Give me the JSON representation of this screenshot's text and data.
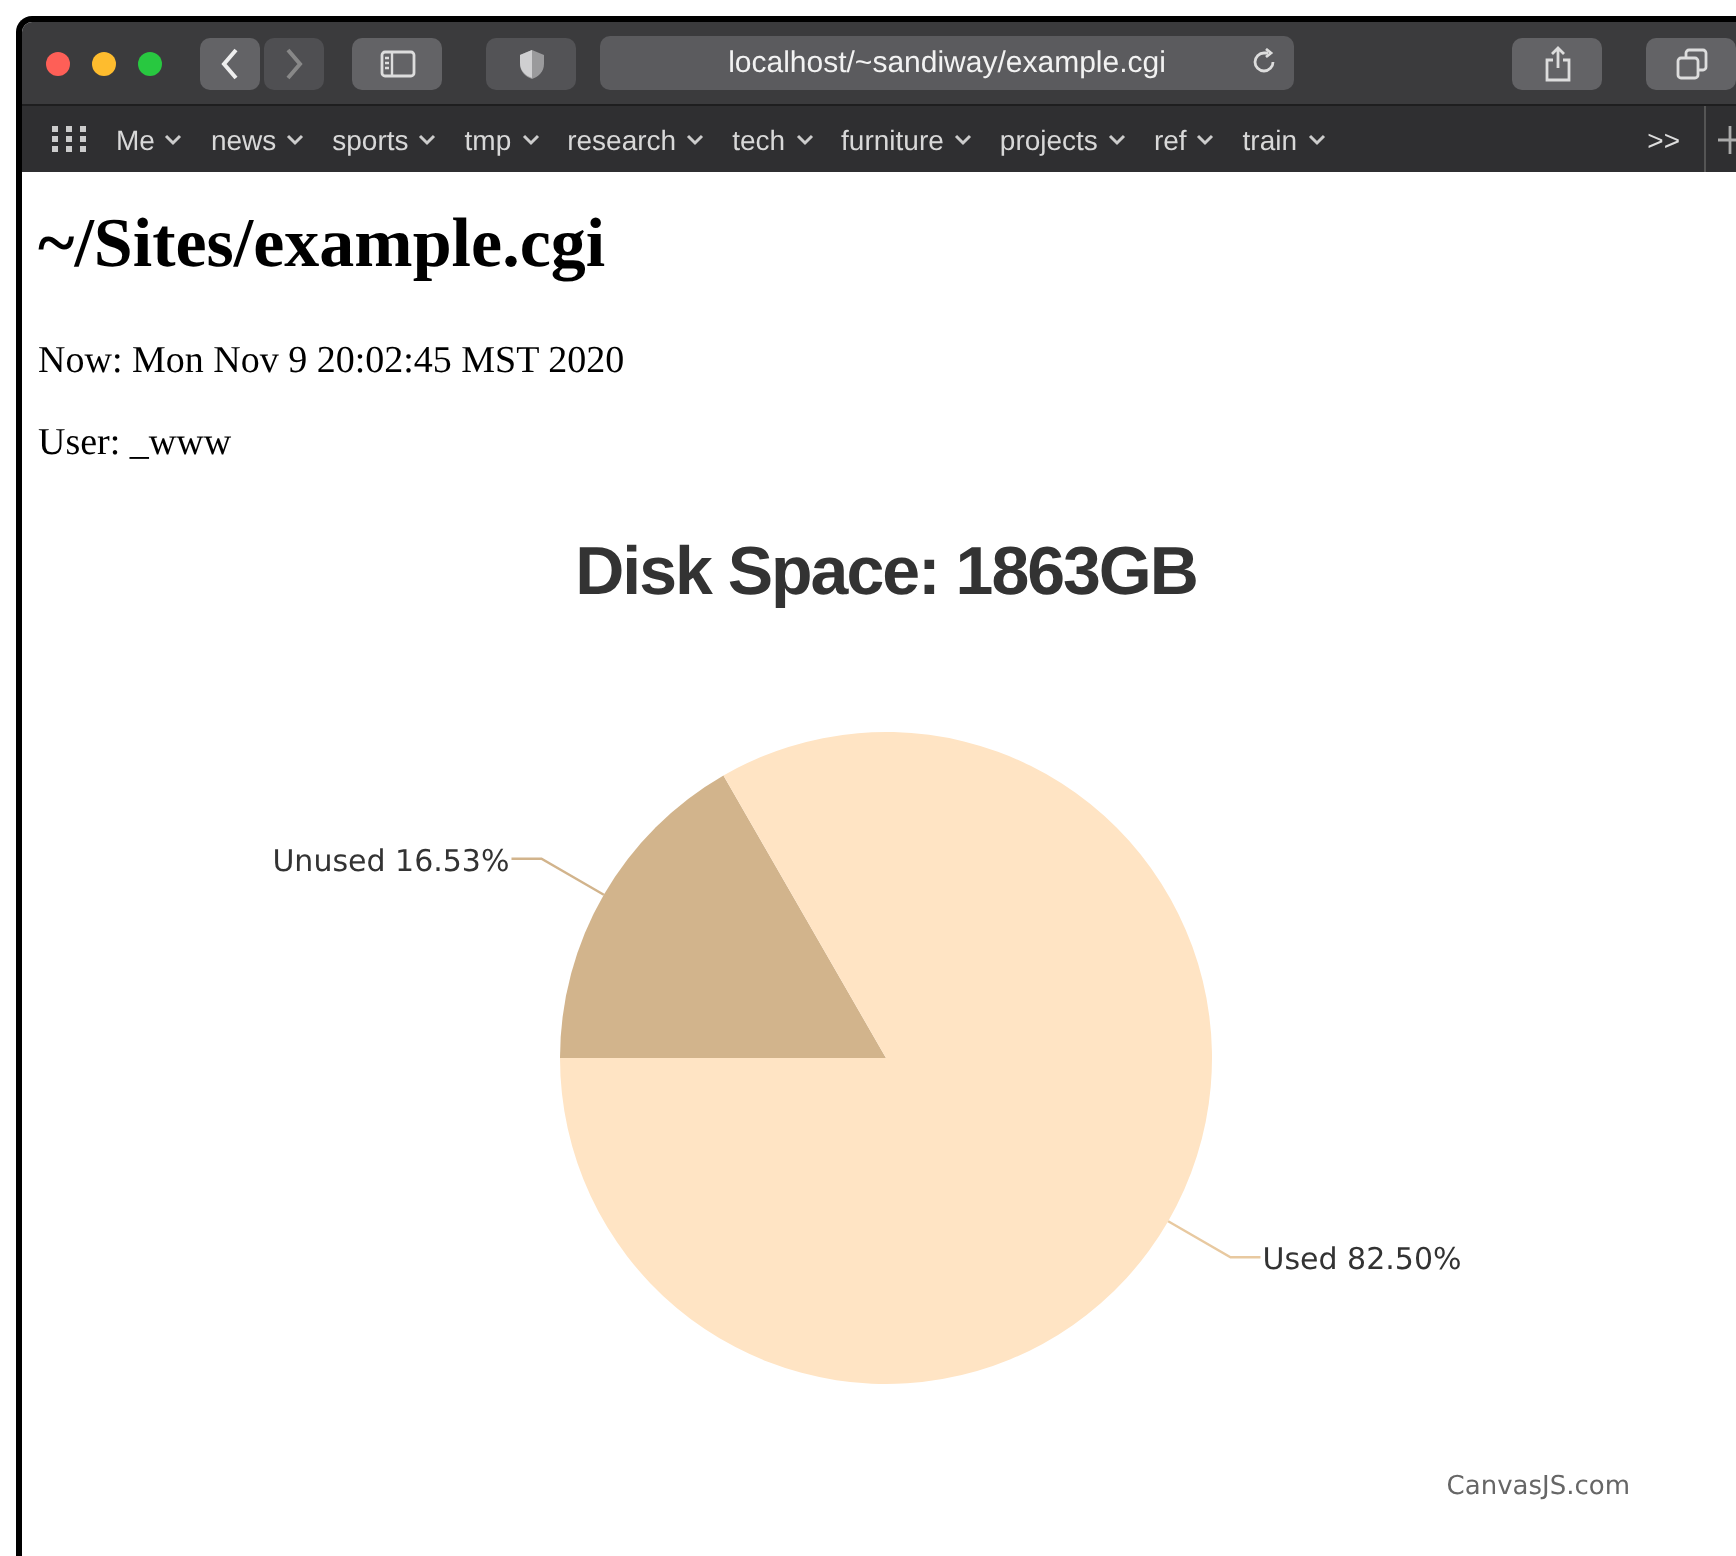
{
  "browser": {
    "url": "localhost/~sandiway/example.cgi",
    "bookmarks": [
      {
        "label": "Me"
      },
      {
        "label": "news"
      },
      {
        "label": "sports"
      },
      {
        "label": "tmp"
      },
      {
        "label": "research"
      },
      {
        "label": "tech"
      },
      {
        "label": "furniture"
      },
      {
        "label": "projects"
      },
      {
        "label": "ref"
      },
      {
        "label": "train"
      }
    ],
    "overflow": ">>"
  },
  "page": {
    "heading": "~/Sites/example.cgi",
    "lines": [
      "Now: Mon Nov 9 20:02:45 MST 2020",
      "User: _www"
    ],
    "chart": {
      "chart_data": {
        "type": "pie",
        "title": "Disk Space: 1863GB",
        "categories": [
          "Unused",
          "Used"
        ],
        "values": [
          16.53,
          82.5
        ],
        "colors": [
          "#d2b48c",
          "#ffe4c4"
        ],
        "value_labels": [
          "16.53%",
          "82.50%"
        ]
      },
      "credit": "CanvasJS.com"
    }
  }
}
